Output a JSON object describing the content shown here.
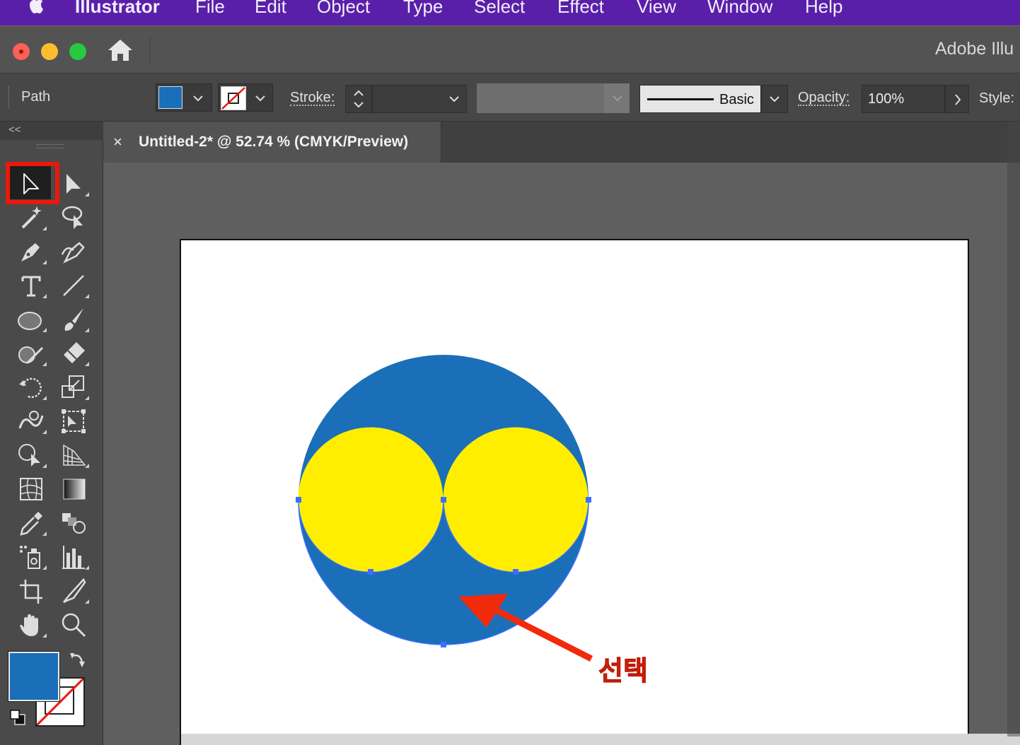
{
  "menubar": {
    "app": "Illustrator",
    "items": [
      "File",
      "Edit",
      "Object",
      "Type",
      "Select",
      "Effect",
      "View",
      "Window",
      "Help"
    ]
  },
  "titlebar": {
    "app_title": "Adobe Illu"
  },
  "controlbar": {
    "selection_label": "Path",
    "stroke_label": "Stroke:",
    "brush_label": "Basic",
    "opacity_label": "Opacity:",
    "opacity_value": "100%",
    "style_label": "Style:"
  },
  "document": {
    "tab_close": "×",
    "tab_title": "Untitled-2* @ 52.74 % (CMYK/Preview)"
  },
  "artwork": {
    "annotation": "선택",
    "colors": {
      "fill": "#1a6fb8",
      "eyes": "#ffee00",
      "arrow": "#f22a0c",
      "anchors": "#3b6fff"
    }
  },
  "tools": {
    "collapse": "<<",
    "items": [
      "selection",
      "direct-selection",
      "magic-wand",
      "lasso",
      "pen",
      "curvature",
      "type",
      "line-segment",
      "ellipse",
      "paintbrush",
      "shaper",
      "eraser",
      "rotate",
      "scale",
      "warp",
      "free-transform",
      "shape-builder",
      "perspective-grid",
      "mesh",
      "gradient",
      "eyedropper",
      "blend",
      "symbol-sprayer",
      "column-graph",
      "artboard",
      "slice",
      "hand",
      "zoom"
    ]
  },
  "colors": {
    "fill_swatch": "#1a6fb8"
  }
}
